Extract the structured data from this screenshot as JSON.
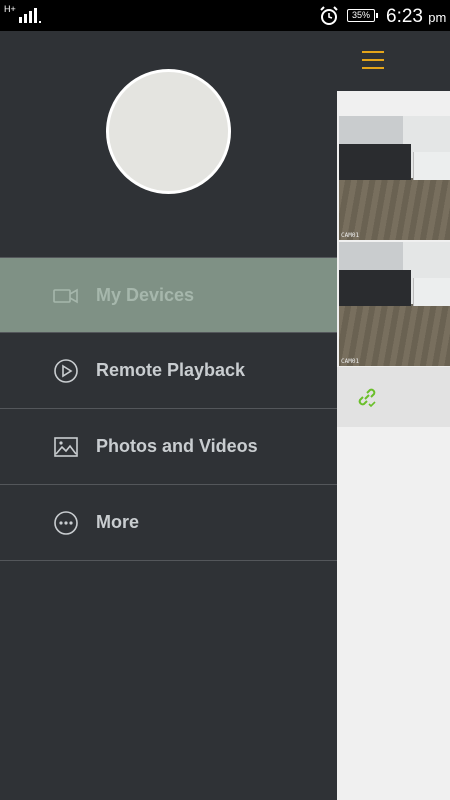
{
  "status_bar": {
    "network": "H+",
    "battery": "35%",
    "time": "6:23",
    "ampm": "pm"
  },
  "app": {
    "cameras": [
      {
        "label": "CAM01"
      },
      {
        "label": "CAM01"
      }
    ]
  },
  "drawer": {
    "items": [
      {
        "label": "My Devices",
        "icon": "video-camera-icon",
        "active": true
      },
      {
        "label": "Remote Playback",
        "icon": "play-circle-icon",
        "active": false
      },
      {
        "label": "Photos and Videos",
        "icon": "image-icon",
        "active": false
      },
      {
        "label": "More",
        "icon": "more-dots-icon",
        "active": false
      }
    ]
  },
  "colors": {
    "drawer_bg": "#2f3236",
    "active_item_bg": "#7f9185",
    "accent": "#e5a51a",
    "link_green": "#6abf2a"
  }
}
